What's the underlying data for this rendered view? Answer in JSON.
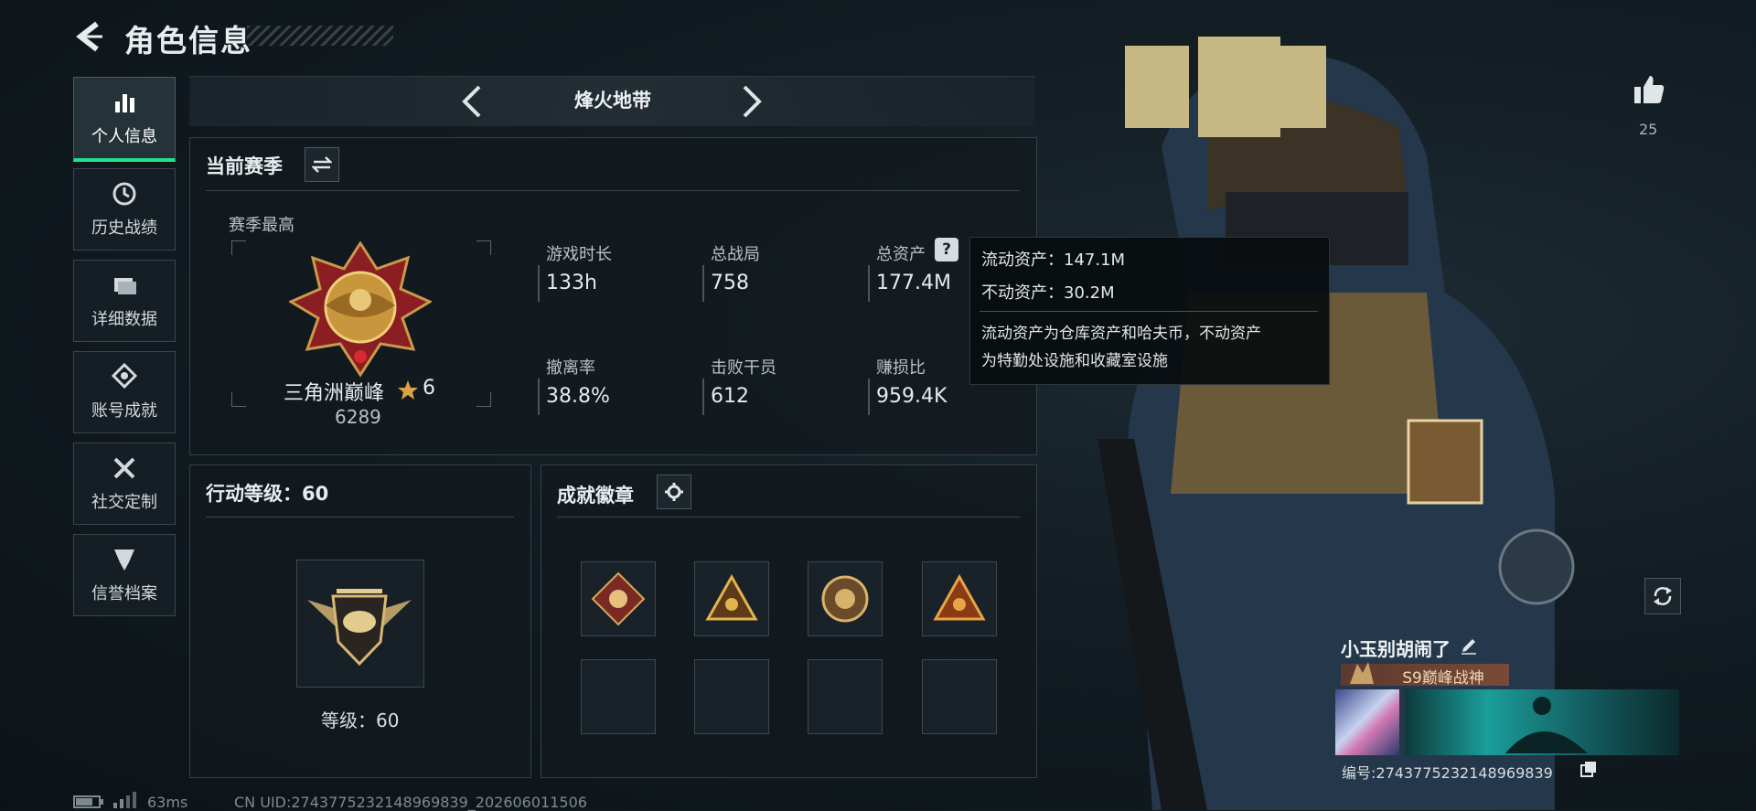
{
  "header": {
    "title": "角色信息"
  },
  "sidebar": {
    "items": [
      {
        "label": "个人信息",
        "active": true,
        "icon": "bar-chart-icon"
      },
      {
        "label": "历史战绩",
        "active": false,
        "icon": "history-icon"
      },
      {
        "label": "详细数据",
        "active": false,
        "icon": "folder-icon"
      },
      {
        "label": "账号成就",
        "active": false,
        "icon": "achievement-icon"
      },
      {
        "label": "社交定制",
        "active": false,
        "icon": "tools-icon"
      },
      {
        "label": "信誉档案",
        "active": false,
        "icon": "credit-icon"
      }
    ]
  },
  "mode": {
    "label": "烽火地带"
  },
  "season": {
    "title": "当前赛季",
    "best_label": "赛季最高",
    "rank_name": "三角洲巅峰",
    "stars": "6",
    "rank_score": "6289",
    "stats": [
      {
        "label": "游戏时长",
        "value": "133h"
      },
      {
        "label": "总战局",
        "value": "758"
      },
      {
        "label": "总资产",
        "value": "177.4M"
      },
      {
        "label": "撤离率",
        "value": "38.8%"
      },
      {
        "label": "击败干员",
        "value": "612"
      },
      {
        "label": "赚损比",
        "value": "959.4K"
      }
    ]
  },
  "tooltip": {
    "liquid": "流动资产：147.1M",
    "fixed": "不动资产：30.2M",
    "desc_line1": "流动资产为仓库资产和哈夫币，不动资产",
    "desc_line2": "为特勤处设施和收藏室设施"
  },
  "action_level": {
    "title": "行动等级：60",
    "level_text": "等级：60"
  },
  "badges": {
    "title": "成就徽章"
  },
  "likes": {
    "count": "25"
  },
  "profile": {
    "name": "小玉别胡闹了",
    "rank_title": "S9巅峰战神",
    "uid": "编号:2743775232148969839"
  },
  "status": {
    "ping": "63ms",
    "cn_uid": "CN UID:2743775232148969839_202606011506"
  },
  "colors": {
    "accent": "#1ee38a",
    "panel_border": "#334048",
    "bg": "#121c22"
  }
}
